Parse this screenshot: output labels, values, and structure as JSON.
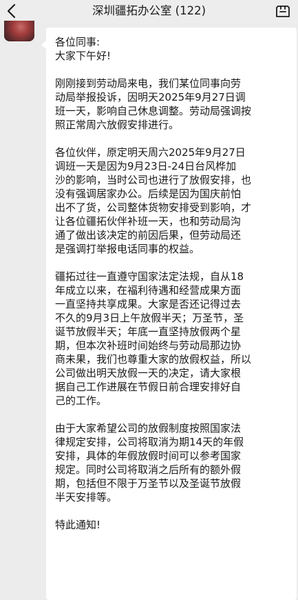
{
  "header": {
    "title": "深圳疆拓办公室 (122)",
    "back_icon": "chevron-left-icon",
    "more_icon": "more-icon"
  },
  "message": {
    "paragraphs": [
      "各位同事:\n大家下午好!",
      "刚刚接到劳动局来电，我们某位同事向劳\n动局举报投诉，因明天2025年9月27日调\n班一天，影响自己休息调整。劳动局强调按\n照正常周六放假安排进行。",
      "各位伙伴，原定明天周六2025年9月27日\n调班一天是因为9月23日-24日台风桦加\n沙的影响，当时公司也进行了放假安排，也\n没有强调居家办公。后续是因为国庆前怕\n出不了货，公司整体货物安排受到影响，才\n让各位疆拓伙伴补班一天，也和劳动局沟\n通了做出该决定的前因后果，但劳动局还\n是强调打举报电话同事的权益。",
      "疆拓过往一直遵守国家法定法规，自从18\n年成立以来，在福利待遇和经营成果方面\n一直坚持共享成果。大家是否还记得过去\n不久的9月3日上午放假半天；万圣节，圣\n诞节放假半天；年底一直坚持放假两个星\n期，但本次补班时间始终与劳动局那边协\n商未果，我们也尊重大家的放假权益，所以\n公司做出明天放假一天的决定，请大家根\n据自己工作进展在节假日前合理安排好自\n己的工作。",
      "由于大家希望公司的放假制度按照国家法\n律规定安排，公司将取消为期14天的年假\n安排，具体的年假放假时间可以参考国家\n规定。同时公司将取消之后所有的额外假\n期，包括但不限于万圣节以及圣诞节放假\n半天安排等。",
      "特此通知!"
    ]
  }
}
